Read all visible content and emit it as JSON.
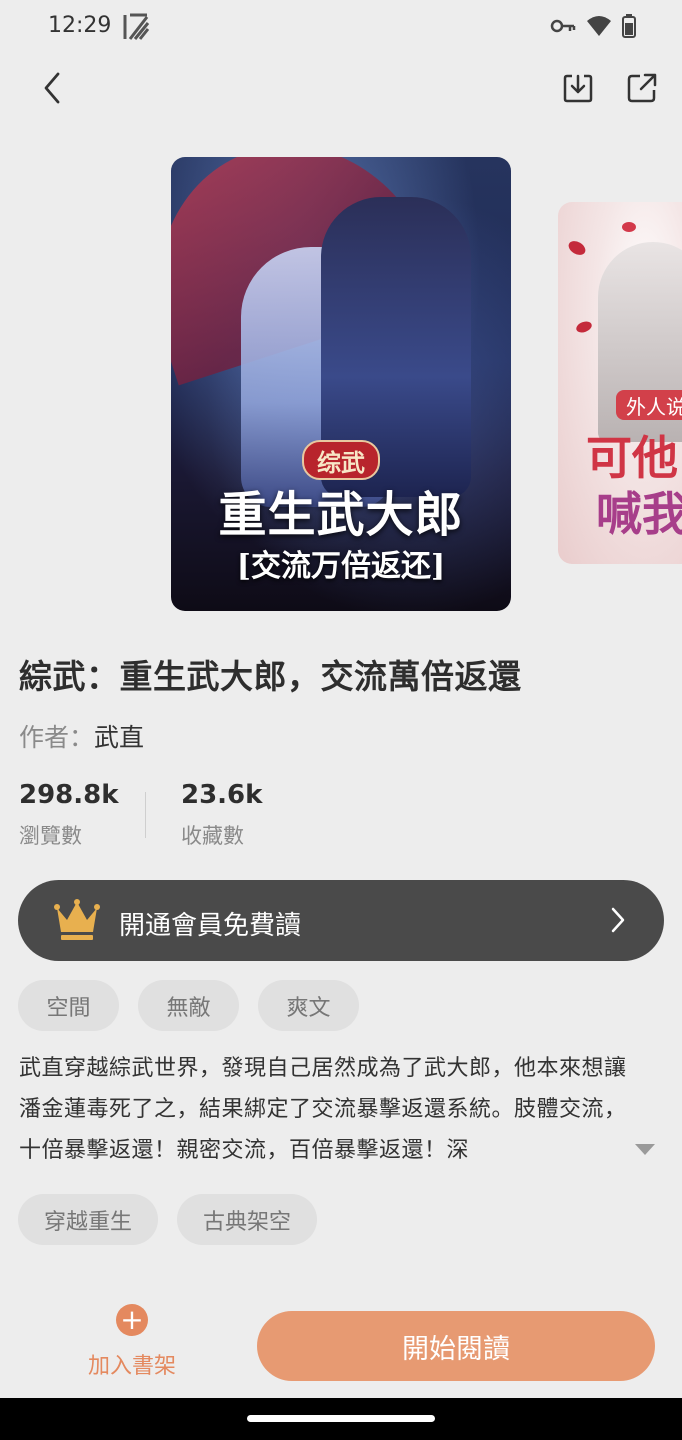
{
  "status_bar": {
    "time": "12:29",
    "icons": [
      "app-logo-icon",
      "key-icon",
      "wifi-icon",
      "battery-icon"
    ]
  },
  "top_bar": {
    "icons": [
      "back-arrow-icon",
      "download-icon",
      "share-icon"
    ]
  },
  "cover": {
    "badge": "综武",
    "title": "重生武大郎",
    "subtitle": "[交流万倍返还]"
  },
  "next_cover": {
    "tag": "外人说",
    "line1": "可他",
    "line2": "喊我"
  },
  "book": {
    "title": "綜武：重生武大郎，交流萬倍返還",
    "author_label": "作者：",
    "author": "武直"
  },
  "stats": [
    {
      "value": "298.8k",
      "label": "瀏覽數"
    },
    {
      "value": "23.6k",
      "label": "收藏數"
    }
  ],
  "vip": {
    "text": "開通會員免費讀",
    "accent": "#e8b04f"
  },
  "tags_primary": [
    "空間",
    "無敵",
    "爽文"
  ],
  "description": "武直穿越綜武世界，發現自己居然成為了武大郎，他本來想讓潘金蓮毒死了之，結果綁定了交流暴擊返還系統。肢體交流，十倍暴擊返還！親密交流，百倍暴擊返還！深",
  "tags_secondary": [
    "穿越重生",
    "古典架空"
  ],
  "bottom": {
    "add_shelf_label": "加入書架",
    "start_read_label": "開始閱讀",
    "accent": "#e79a72"
  }
}
